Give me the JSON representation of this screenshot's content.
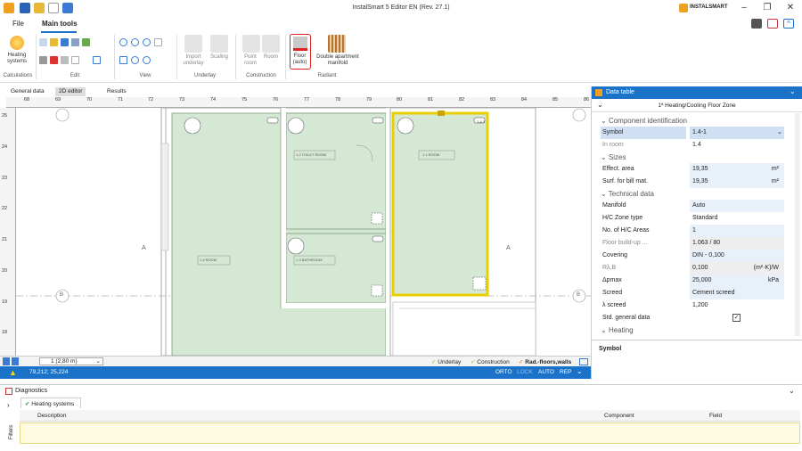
{
  "title": "InstalSmart 5 Editor EN (Rev. 27.1)",
  "brand": "INSTALSMART",
  "tabs": [
    "File",
    "Main tools"
  ],
  "ribbon": {
    "heating_systems": "Heating systems",
    "import_underlay": "Import underlay",
    "scaling": "Scaling",
    "point_room": "Point room",
    "room": "Room",
    "floor_auto": "Floor (auto)",
    "double_manifold": "Double apartment manifold",
    "groups": [
      "Calculations",
      "Edit",
      "View",
      "Underlay",
      "Construction",
      "Radiant"
    ]
  },
  "doc_tabs": [
    "General data",
    "2D editor",
    "Results"
  ],
  "ruler_labels": [
    "68",
    "69",
    "70",
    "71",
    "72",
    "73",
    "74",
    "75",
    "76",
    "77",
    "78",
    "79",
    "80",
    "81",
    "82",
    "83",
    "84",
    "85",
    "86"
  ],
  "vruler_labels": [
    "25",
    "24",
    "23",
    "22",
    "21",
    "20",
    "19",
    "18"
  ],
  "canvas": {
    "axis_a": "A",
    "axis_b": "B",
    "room_labels": [
      "1.4 ROOM",
      "1.3 BATHROOM",
      "1.2 TOILET ROOM",
      "1.1 ROOM",
      "1.4-1"
    ]
  },
  "bottom": {
    "level": "1 (2,80 m)",
    "layers": [
      "Underlay",
      "Construction",
      "Rad.-floors,walls"
    ]
  },
  "status": {
    "coords": "79,212; 25,224",
    "modes": [
      "ORTO",
      "LOCK",
      "AUTO",
      "REP"
    ]
  },
  "panel": {
    "header": "Data table",
    "subtitle": "1ª Heating/Cooling Floor Zone",
    "sections": {
      "comp": "Component identification",
      "sizes": "Sizes",
      "tech": "Technical data",
      "heating": "Heating"
    },
    "rows": [
      {
        "label": "Symbol",
        "value": "1.4-1",
        "unit": ""
      },
      {
        "label": "In room",
        "value": "1.4",
        "unit": ""
      },
      {
        "label": "Effect. area",
        "value": "19,35",
        "unit": "m²"
      },
      {
        "label": "Surf. for bill mat.",
        "value": "19,35",
        "unit": "m²"
      },
      {
        "label": "Manifold",
        "value": "Auto",
        "unit": ""
      },
      {
        "label": "H/C Zone type",
        "value": "Standard",
        "unit": ""
      },
      {
        "label": "No. of H/C Areas",
        "value": "1",
        "unit": ""
      },
      {
        "label": "Floor build-up ...",
        "value": "1.063 / 80",
        "unit": ""
      },
      {
        "label": "Covering",
        "value": "DIN - 0,100",
        "unit": ""
      },
      {
        "label": "Rλ,B",
        "value": "0,100",
        "unit": "(m²·K)/W"
      },
      {
        "label": "Δpmax",
        "value": "25,000",
        "unit": "kPa"
      },
      {
        "label": "Screed",
        "value": "Cement screed",
        "unit": ""
      },
      {
        "label": "λ screed",
        "value": "1,200",
        "unit": ""
      },
      {
        "label": "Std. general data",
        "value": "",
        "unit": ""
      }
    ],
    "footer": "Symbol"
  },
  "diagnostics": {
    "title": "Diagnostics",
    "tab": "Heating systems",
    "cols": [
      "Description",
      "Component",
      "Field"
    ],
    "side": "Filters"
  }
}
